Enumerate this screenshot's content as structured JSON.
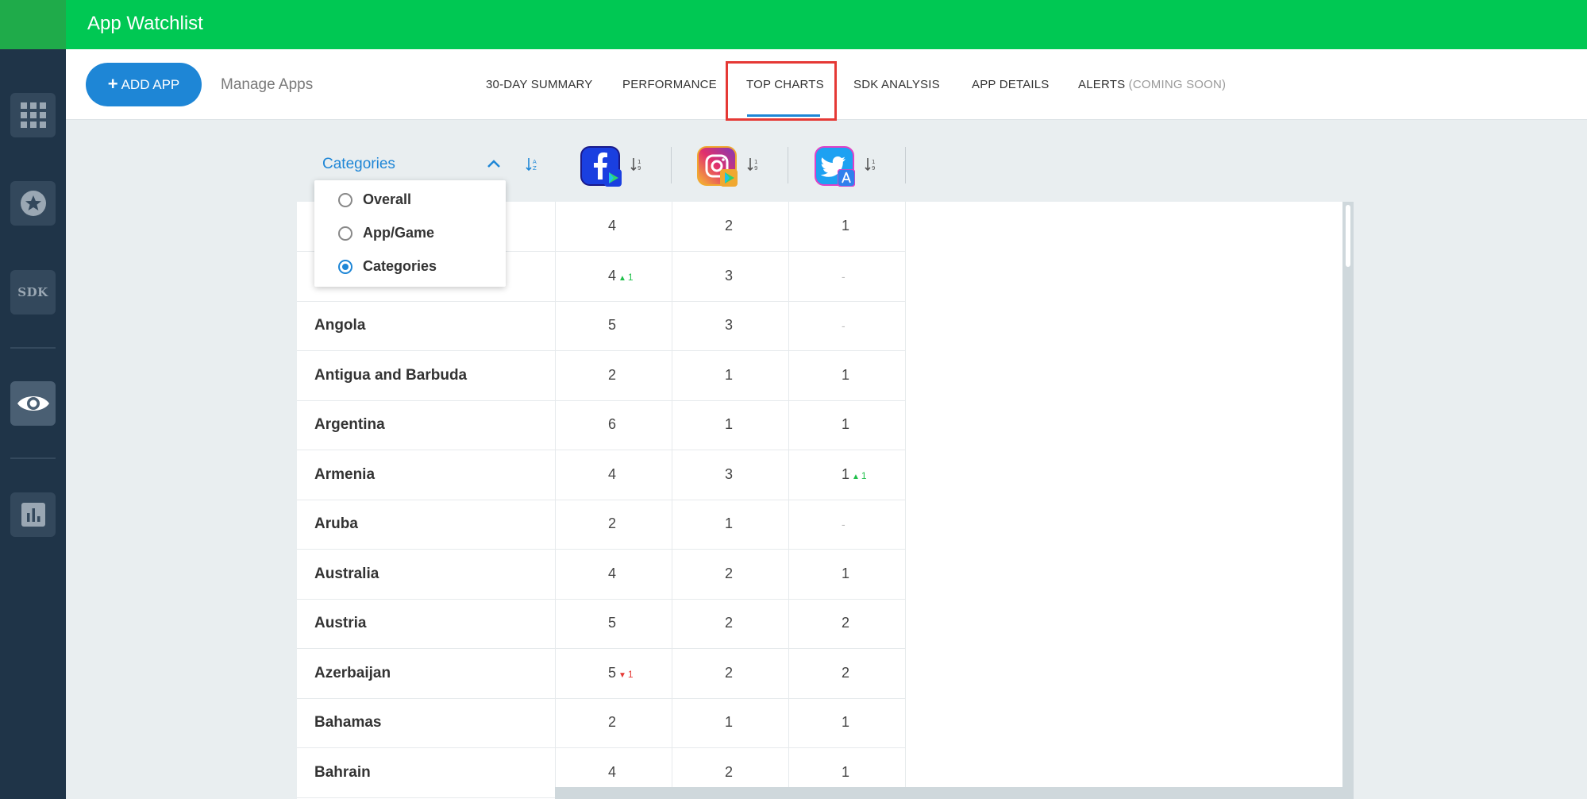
{
  "header": {
    "title": "App Watchlist"
  },
  "toolbar": {
    "add_app_label": "ADD APP",
    "manage_apps_label": "Manage Apps"
  },
  "tabs": [
    {
      "label": "30-DAY SUMMARY"
    },
    {
      "label": "PERFORMANCE"
    },
    {
      "label": "TOP CHARTS",
      "active": true
    },
    {
      "label": "SDK ANALYSIS"
    },
    {
      "label": "APP DETAILS"
    },
    {
      "label": "ALERTS",
      "suffix": "(COMING SOON)"
    }
  ],
  "sidebar": {
    "sdk_label": "SDK"
  },
  "table": {
    "group_by_label": "Categories",
    "group_by_options": [
      {
        "label": "Overall",
        "selected": false
      },
      {
        "label": "App/Game",
        "selected": false
      },
      {
        "label": "Categories",
        "selected": true
      }
    ],
    "columns": [
      {
        "app": "facebook-icon",
        "store": "google-play"
      },
      {
        "app": "instagram-icon",
        "store": "google-play"
      },
      {
        "app": "twitter-icon",
        "store": "app-store"
      }
    ],
    "rows": [
      {
        "country": "",
        "values": [
          "4",
          "2",
          "1"
        ],
        "deltas": [
          null,
          null,
          null
        ]
      },
      {
        "country": "",
        "values": [
          "4",
          "3",
          "-"
        ],
        "deltas": [
          {
            "dir": "up",
            "value": "1"
          },
          null,
          null
        ]
      },
      {
        "country": "Angola",
        "values": [
          "5",
          "3",
          "-"
        ],
        "deltas": [
          null,
          null,
          null
        ]
      },
      {
        "country": "Antigua and Barbuda",
        "values": [
          "2",
          "1",
          "1"
        ],
        "deltas": [
          null,
          null,
          null
        ]
      },
      {
        "country": "Argentina",
        "values": [
          "6",
          "1",
          "1"
        ],
        "deltas": [
          null,
          null,
          null
        ]
      },
      {
        "country": "Armenia",
        "values": [
          "4",
          "3",
          "1"
        ],
        "deltas": [
          null,
          null,
          {
            "dir": "up",
            "value": "1"
          }
        ]
      },
      {
        "country": "Aruba",
        "values": [
          "2",
          "1",
          "-"
        ],
        "deltas": [
          null,
          null,
          null
        ]
      },
      {
        "country": "Australia",
        "values": [
          "4",
          "2",
          "1"
        ],
        "deltas": [
          null,
          null,
          null
        ]
      },
      {
        "country": "Austria",
        "values": [
          "5",
          "2",
          "2"
        ],
        "deltas": [
          null,
          null,
          null
        ]
      },
      {
        "country": "Azerbaijan",
        "values": [
          "5",
          "2",
          "2"
        ],
        "deltas": [
          {
            "dir": "down",
            "value": "1"
          },
          null,
          null
        ]
      },
      {
        "country": "Bahamas",
        "values": [
          "2",
          "1",
          "1"
        ],
        "deltas": [
          null,
          null,
          null
        ]
      },
      {
        "country": "Bahrain",
        "values": [
          "4",
          "2",
          "1"
        ],
        "deltas": [
          null,
          null,
          null
        ]
      }
    ]
  },
  "colors": {
    "brand_green": "#00c853",
    "accent_blue": "#1e86d6",
    "sidebar": "#1f3448",
    "highlight": "#e53935",
    "up": "#1fbf4a",
    "down": "#e53935"
  }
}
